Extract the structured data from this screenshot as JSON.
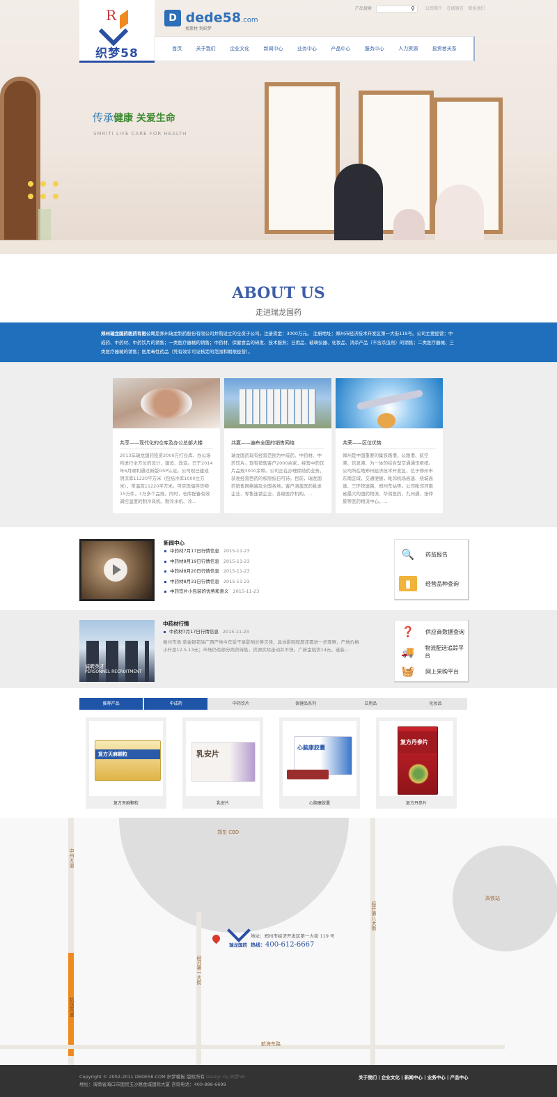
{
  "header": {
    "logo_mark": "R",
    "logo_text": "织梦58",
    "brand": "dede58",
    "brand_suffix": ".com",
    "brand_slogan": "找素材 到织梦",
    "search_label": "产品搜索",
    "search_placeholder": "",
    "top_links": [
      "公司简介",
      "在线留言",
      "联系我们"
    ],
    "nav": [
      "首页",
      "关于我们",
      "企业文化",
      "新闻中心",
      "业务中心",
      "产品中心",
      "服务中心",
      "人力资源",
      "投资者关系"
    ]
  },
  "hero": {
    "slogan_cursive": "传承",
    "slogan_main": "健康  关爱生命",
    "slogan_en": "SMRITI LIFE  CARE FOR HEALTH"
  },
  "about": {
    "title": "ABOUT US",
    "subtitle": "走进瑞龙国药",
    "company": "郑州瑞龙国药医药有限公司",
    "text": "是郑州瑞龙制药股份有限公司并购设立的全资子公司，注册资金：3000万元。 注册地址：郑州市经济技术开发区第一大街119号。公司主要经营：中成药、中药材、中药饮片的销售；一类医疗器械的销售；中药材、保健食品的研发、技术服务；日用品、玻璃仪器、化妆品、消杀产品（不含杀虫剂）的销售；二类医疗器械、三类医疗器械的销售；医用毒性药品（凭有效许可证核定的范围和期限经营）。"
  },
  "cards": [
    {
      "title": "共享——现代化的仓库及办公总部大楼",
      "text": "2013年瑞龙国药投资2000万打仓库、办公场所进行全方位的设计、建设、改造。已于2014年6月顺利通过新版GSP认证。公司现已建成阴凉库11220平方米（包括冷库1000立方米），常温库11220平方米。可实现储存货物15万件，1万多个品规。同时，仓库配备有效调控温度的制冷风机、制冷水机、冷..."
    },
    {
      "title": "共赢——遍布全国的销售网络",
      "text": "瑞龙国药现有经营范围为中成药、中药材、中药饮片。现有销售客户2000余家，经营中药饮片品规3000余种。公司正在办理缔结药业务，获准经营西药的权限指日可待。目前，瑞龙国药销售网络遍及全国各地，客户涵盖医药批发企业、零售连锁企业、各级医疗机构。..."
    },
    {
      "title": "共荣——区位优势",
      "text": "郑州是中国重要的集铁路港、公路港、航空港、信息港、为一体的综合型交通通讯枢纽。公司所在地郑州经济技术开发区，位于郑州市东南区域，交通便捷，毗邻机场高速、绕城高速、三环快速路、郑州东站等。公司毗邻河南省最大的国药物流、华润医药、九州通、张仲景等医药物流中心。..."
    }
  ],
  "news": {
    "title": "新闻中心",
    "items": [
      {
        "title": "中药材7月17日行情信息",
        "date": "2015-11-23"
      },
      {
        "title": "中药材8月19日行情信息",
        "date": "2015-11-23"
      },
      {
        "title": "中药材8月20日行情信息",
        "date": "2015-11-23"
      },
      {
        "title": "中药材8月31日行情信息",
        "date": "2015-11-23"
      },
      {
        "title": "中药饮片小包装的优势和意义",
        "date": "2015-11-23"
      }
    ]
  },
  "side1": [
    "药监报告",
    "经营品种查询"
  ],
  "herb": {
    "title": "中药材行情",
    "item_title": "中药材7月17日行情信息",
    "item_date": "2015-11-23",
    "desc": "亳州市场 草金银花除广西产地今年受干旱影响长势欠佳，具体影响程度还需进一步观察，产地价格小升至12.5-13元；市场仍有部分商货待售，货源实际走动并不快，广新金桃货14元，选装..."
  },
  "recruit": {
    "cn": "诚聘英才",
    "en": "PERSONNEL RECRUITMENT"
  },
  "side2": [
    "供应商数据查询",
    "物流配送追踪平台",
    "网上采购平台"
  ],
  "product_tabs": [
    "推荐产品",
    "中成药",
    "中药饮片",
    "保健品系列",
    "日用品",
    "化妆品"
  ],
  "products": [
    {
      "name": "复方天麻颗粒",
      "box_text": "复方天麻颗粒"
    },
    {
      "name": "乳安片",
      "box_text": "乳安片"
    },
    {
      "name": "心脑康胶囊",
      "box_text": "心脑康胶囊"
    },
    {
      "name": "复方丹参片",
      "box_text": "复方丹参片"
    }
  ],
  "map": {
    "cbd": "郑东 CBD",
    "station": "高铁站",
    "road_left": "中州大道",
    "road_left2": "机场高速",
    "road_mid": "经开第一大街",
    "road_right": "经开第八大街",
    "road_bottom": "航海东路",
    "company": "瑞龙国药",
    "address_label": "地址：",
    "address": "郑州市经济开发区第一大街 119 号",
    "hotline_label": "热线：",
    "hotline": "400-612-6667"
  },
  "footer": {
    "copyright": "Copyright © 2002-2011 DEDE58.COM 织梦模板 版权所有",
    "design": "Design by 织梦58",
    "address_line": "地址：海南省海口市国贸玉沙路金城国际大厦 咨询电话：400-888-6699",
    "links": [
      "关于我们",
      "企业文化",
      "新闻中心",
      "业务中心",
      "产品中心"
    ]
  },
  "colors": {
    "primary": "#1f6fbc",
    "nav_blue": "#2a4fa3",
    "footer": "#333333"
  }
}
